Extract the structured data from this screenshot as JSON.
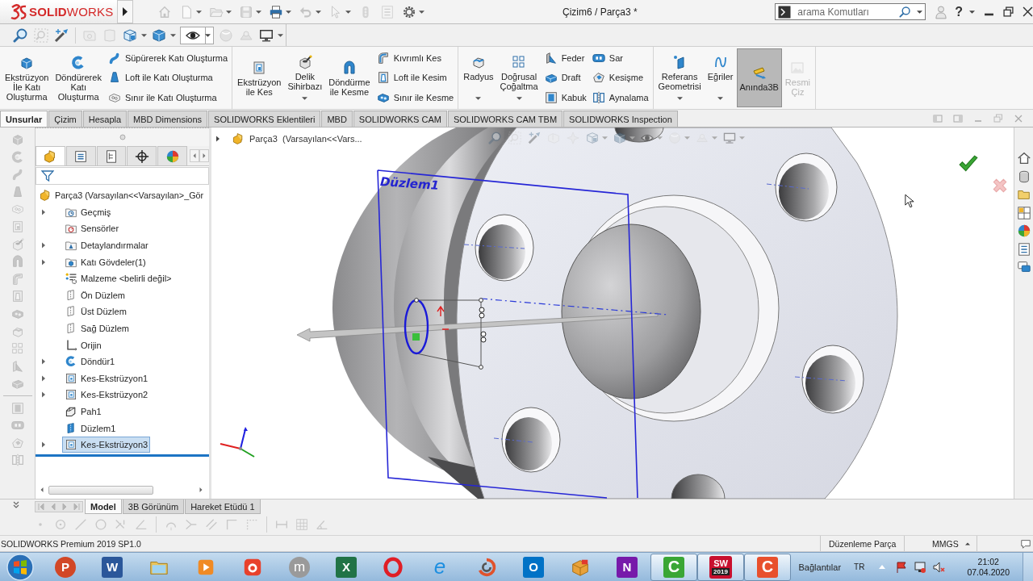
{
  "title_bar": {
    "logo": "**SOLID**WORKS",
    "title": "Çizim6 / Parça3 *",
    "search": {
      "placeholder": "arama Komutları"
    },
    "help": "?"
  },
  "view_toolbar": {
    "eye_toggle": {
      "on": true
    }
  },
  "ribbon": {
    "groups": [
      {
        "large": [
          {
            "label": "Ekstrüzyon\nİle Katı\nOluşturma",
            "kind": "extrude",
            "dropdown": false,
            "on": false,
            "disabled": false
          },
          {
            "label": "Döndürerek\nKatı\nOluşturma",
            "kind": "revolve",
            "dropdown": false,
            "on": false,
            "disabled": false
          }
        ],
        "columns": [
          [
            {
              "label": "Süpürerek Katı Oluşturma",
              "kind": "sweep"
            },
            {
              "label": "Loft ile Katı Oluşturma",
              "kind": "loft"
            },
            {
              "label": "Sınır ile Katı Oluşturma",
              "kind": "boundary"
            }
          ]
        ]
      },
      {
        "large": [
          {
            "label": "Ekstrüzyon\nile Kes",
            "kind": "cut-extrude",
            "dropdown": false,
            "on": false,
            "disabled": false
          },
          {
            "label": "Delik\nSihirbazı",
            "kind": "hole",
            "dropdown": true,
            "on": false,
            "disabled": false
          },
          {
            "label": "Döndürme\nile Kesme",
            "kind": "revolve-cut",
            "dropdown": false,
            "on": false,
            "disabled": false
          }
        ],
        "columns": [
          [
            {
              "label": "Kıvrımlı Kes",
              "kind": "swept-cut"
            },
            {
              "label": "Loft ile Kesim",
              "kind": "loft-cut"
            },
            {
              "label": "Sınır ile Kesme",
              "kind": "boundary-cut"
            }
          ]
        ]
      },
      {
        "large": [
          {
            "label": "Radyus",
            "kind": "fillet",
            "dropdown": true,
            "on": false,
            "disabled": false
          },
          {
            "label": "Doğrusal\nÇoğaltma",
            "kind": "pattern",
            "dropdown": true,
            "on": false,
            "disabled": false
          }
        ],
        "columns": [
          [
            {
              "label": "Feder",
              "kind": "rib"
            },
            {
              "label": "Draft",
              "kind": "draft"
            },
            {
              "label": "Kabuk",
              "kind": "shell"
            }
          ],
          [
            {
              "label": "Sar",
              "kind": "wrap"
            },
            {
              "label": "Kesişme",
              "kind": "intersect"
            },
            {
              "label": "Aynalama",
              "kind": "mirror"
            }
          ]
        ]
      },
      {
        "large": [
          {
            "label": "Referans\nGeometrisi",
            "kind": "reference",
            "dropdown": true,
            "on": false,
            "disabled": false
          },
          {
            "label": "Eğriler",
            "kind": "curves",
            "dropdown": true,
            "on": false,
            "disabled": false
          },
          {
            "label": "Anında3B",
            "kind": "instant3d",
            "dropdown": false,
            "on": true,
            "disabled": false
          },
          {
            "label": "Resmi\nÇiz",
            "kind": "picture",
            "dropdown": false,
            "on": false,
            "disabled": true
          }
        ]
      }
    ]
  },
  "tabs": [
    {
      "label": "Unsurlar",
      "selected": true
    },
    {
      "label": "Çizim",
      "selected": false
    },
    {
      "label": "Hesapla",
      "selected": false
    },
    {
      "label": "MBD Dimensions",
      "selected": false
    },
    {
      "label": "SOLIDWORKS Eklentileri",
      "selected": false
    },
    {
      "label": "MBD",
      "selected": false
    },
    {
      "label": "SOLIDWORKS CAM",
      "selected": false
    },
    {
      "label": "SOLIDWORKS CAM TBM",
      "selected": false
    },
    {
      "label": "SOLIDWORKS Inspection",
      "selected": false
    }
  ],
  "feature_manager": {
    "tabs": [
      {
        "selected": true
      },
      {
        "selected": false
      },
      {
        "selected": false
      },
      {
        "selected": false
      },
      {
        "selected": false
      }
    ],
    "root": "Parça3 (Varsayılan<<Varsayılan>_Gör",
    "items": [
      {
        "label": "Geçmiş",
        "kind": "history",
        "has_children": true,
        "selected": false
      },
      {
        "label": "Sensörler",
        "kind": "sensor",
        "has_children": false,
        "selected": false
      },
      {
        "label": "Detaylandırmalar",
        "kind": "annotation",
        "has_children": true,
        "selected": false
      },
      {
        "label": "Katı Gövdeler(1)",
        "kind": "bodies",
        "has_children": true,
        "selected": false
      },
      {
        "label": "Malzeme <belirli değil>",
        "kind": "material",
        "has_children": false,
        "selected": false
      },
      {
        "label": "Ön Düzlem",
        "kind": "plane",
        "has_children": false,
        "selected": false
      },
      {
        "label": "Üst Düzlem",
        "kind": "plane",
        "has_children": false,
        "selected": false
      },
      {
        "label": "Sağ Düzlem",
        "kind": "plane",
        "has_children": false,
        "selected": false
      },
      {
        "label": "Orijin",
        "kind": "origin",
        "has_children": false,
        "selected": false
      },
      {
        "label": "Döndür1",
        "kind": "revolve",
        "has_children": true,
        "selected": false
      },
      {
        "label": "Kes-Ekstrüzyon1",
        "kind": "cut",
        "has_children": true,
        "selected": false
      },
      {
        "label": "Kes-Ekstrüzyon2",
        "kind": "cut",
        "has_children": true,
        "selected": false
      },
      {
        "label": "Pah1",
        "kind": "chamfer",
        "has_children": false,
        "selected": false
      },
      {
        "label": "Düzlem1",
        "kind": "refplane",
        "has_children": false,
        "selected": false
      },
      {
        "label": "Kes-Ekstrüzyon3",
        "kind": "cut",
        "has_children": true,
        "selected": true
      }
    ]
  },
  "viewport": {
    "breadcrumb": "Parça3  (Varsayılan<<Vars...",
    "plane_label": "Düzlem1"
  },
  "bottom_tabs": [
    {
      "label": "Model",
      "selected": true
    },
    {
      "label": "3B Görünüm",
      "selected": false
    },
    {
      "label": "Hareket Etüdü 1",
      "selected": false
    }
  ],
  "status_bar": {
    "product": "SOLIDWORKS Premium 2019 SP1.0",
    "mode": "Düzenleme Parça",
    "units": "MMGS"
  },
  "taskbar": {
    "apps": [
      {
        "kind": "slides",
        "glyph": "P",
        "active": false
      },
      {
        "kind": "document",
        "glyph": "W",
        "active": false
      },
      {
        "kind": "folder",
        "active": false
      },
      {
        "kind": "player",
        "active": false
      },
      {
        "kind": "camera",
        "active": false
      },
      {
        "kind": "disc",
        "glyph": "m",
        "active": false
      },
      {
        "kind": "sheet",
        "glyph": "X",
        "active": false
      },
      {
        "kind": "ring",
        "active": false
      },
      {
        "kind": "browser",
        "glyph": "e",
        "active": false
      },
      {
        "kind": "swirl",
        "active": false
      },
      {
        "kind": "mail",
        "glyph": "O",
        "active": false
      },
      {
        "kind": "box",
        "active": false
      },
      {
        "kind": "notes",
        "glyph": "N",
        "active": false
      },
      {
        "kind": "recorder",
        "glyph": "C",
        "active": true
      },
      {
        "kind": "cad",
        "glyph": "SW",
        "badge": "2019",
        "active": true
      },
      {
        "kind": "capture",
        "glyph": "C",
        "active": true
      }
    ],
    "tray": {
      "links": "Bağlantılar",
      "language": "TR",
      "time": "21:02",
      "date": "07.04.2020"
    }
  }
}
